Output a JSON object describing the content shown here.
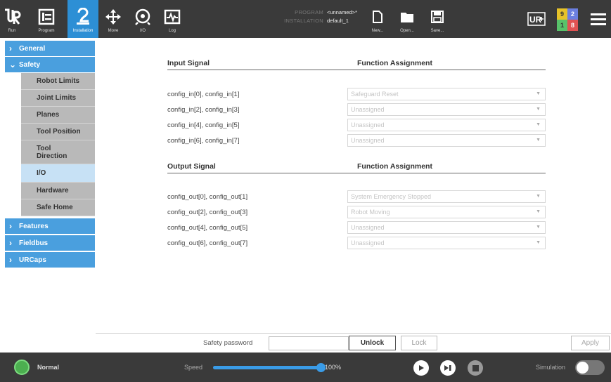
{
  "header": {
    "nav": [
      {
        "label": "Run",
        "icon": "ur-logo-icon"
      },
      {
        "label": "Program",
        "icon": "program-icon"
      },
      {
        "label": "Installation",
        "icon": "installation-icon",
        "active": true
      },
      {
        "label": "Move",
        "icon": "move-icon"
      },
      {
        "label": "I/O",
        "icon": "io-icon"
      },
      {
        "label": "Log",
        "icon": "log-icon"
      }
    ],
    "program_key": "PROGRAM",
    "program_value": "<unnamed>*",
    "installation_key": "INSTALLATION",
    "installation_value": "default_1",
    "file_actions": [
      {
        "label": "New...",
        "icon": "new-file-icon"
      },
      {
        "label": "Open...",
        "icon": "folder-icon"
      },
      {
        "label": "Save...",
        "icon": "save-icon"
      }
    ],
    "speed_badge": {
      "tl": "9",
      "tr": "2",
      "bl": "1",
      "br": "8"
    },
    "colors": {
      "bar": "#3a3a3a",
      "active": "#2d8fd5"
    }
  },
  "sidebar": {
    "general": "General",
    "safety": "Safety",
    "safety_items": [
      "Robot Limits",
      "Joint Limits",
      "Planes",
      "Tool Position",
      "Tool Direction",
      "I/O",
      "Hardware",
      "Safe Home"
    ],
    "selected": "I/O",
    "features": "Features",
    "fieldbus": "Fieldbus",
    "urcaps": "URCaps"
  },
  "main": {
    "input_header": "Input Signal",
    "input_func_header": "Function Assignment",
    "inputs": [
      {
        "signal": "config_in[0], config_in[1]",
        "function": "Safeguard Reset"
      },
      {
        "signal": "config_in[2], config_in[3]",
        "function": "Unassigned"
      },
      {
        "signal": "config_in[4], config_in[5]",
        "function": "Unassigned"
      },
      {
        "signal": "config_in[6], config_in[7]",
        "function": "Unassigned"
      }
    ],
    "output_header": "Output Signal",
    "output_func_header": "Function Assignment",
    "outputs": [
      {
        "signal": "config_out[0], config_out[1]",
        "function": "System Emergency Stopped"
      },
      {
        "signal": "config_out[2], config_out[3]",
        "function": "Robot Moving"
      },
      {
        "signal": "config_out[4], config_out[5]",
        "function": "Unassigned"
      },
      {
        "signal": "config_out[6], config_out[7]",
        "function": "Unassigned"
      }
    ]
  },
  "footer": {
    "password_label": "Safety password",
    "password_value": "",
    "unlock": "Unlock",
    "lock": "Lock",
    "apply": "Apply"
  },
  "status": {
    "state": "Normal",
    "speed_label": "Speed",
    "speed_value": "100%",
    "speed_fraction": 1.0,
    "simulation_label": "Simulation",
    "simulation_on": false
  }
}
